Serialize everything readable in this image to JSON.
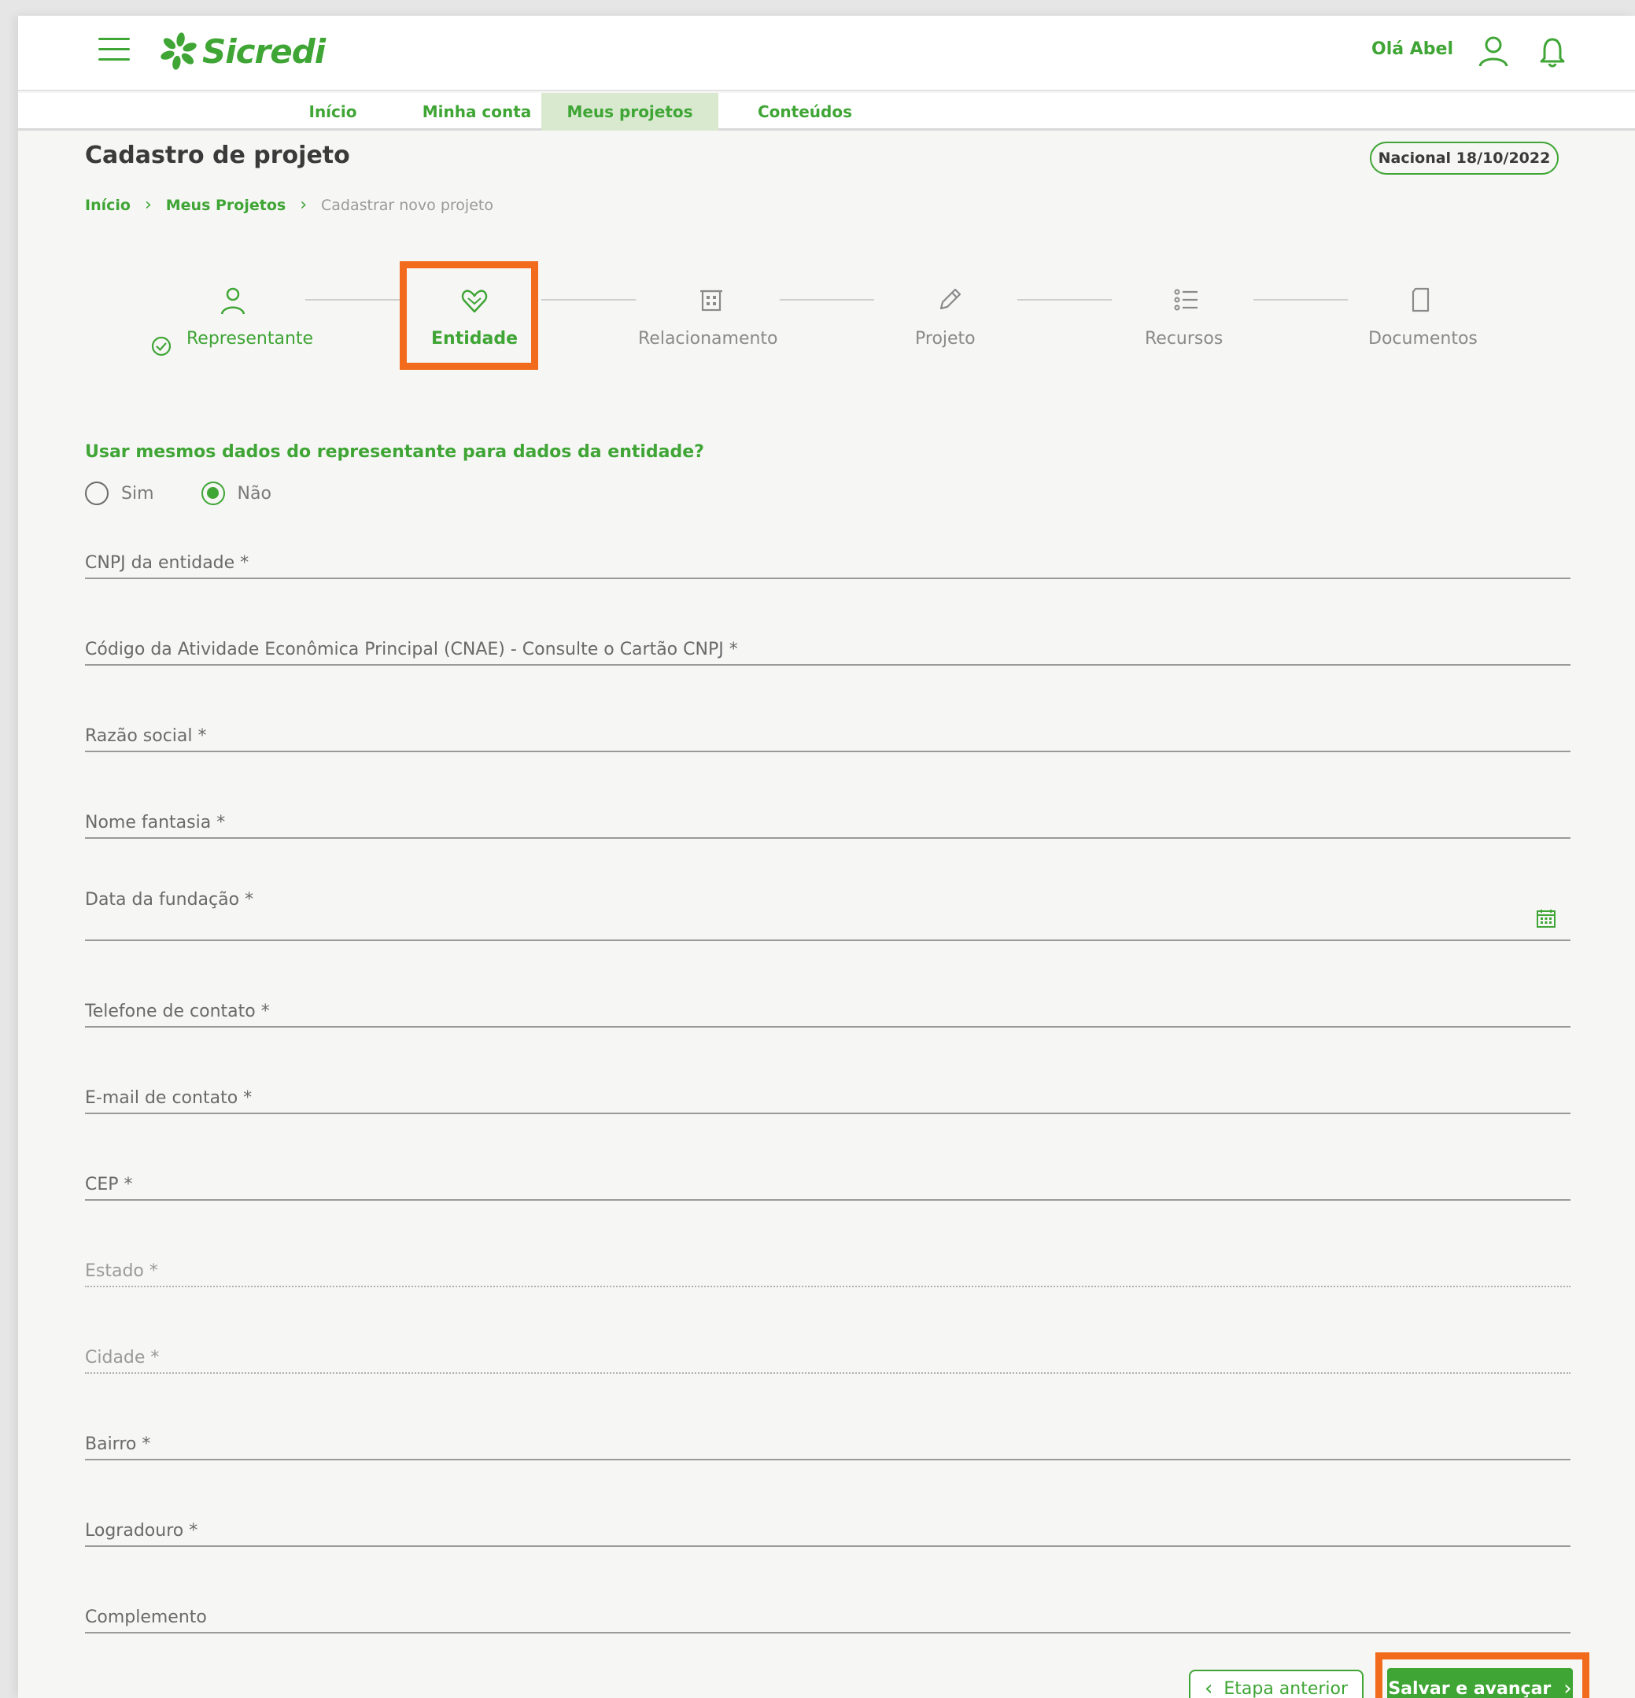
{
  "header": {
    "logo_text": "Sicredi",
    "greeting": "Olá Abel"
  },
  "nav": {
    "tabs": [
      {
        "label": "Início"
      },
      {
        "label": "Minha conta"
      },
      {
        "label": "Meus projetos"
      },
      {
        "label": "Conteúdos"
      }
    ],
    "active_tab": "Meus projetos"
  },
  "page": {
    "title": "Cadastro de projeto",
    "badge": "Nacional 18/10/2022",
    "breadcrumb": [
      "Início",
      "Meus Projetos",
      "Cadastrar novo projeto"
    ]
  },
  "stepper": {
    "steps": [
      {
        "label": "Representante",
        "icon": "user-icon",
        "status": "done"
      },
      {
        "label": "Entidade",
        "icon": "heart-hands-icon",
        "status": "current"
      },
      {
        "label": "Relacionamento",
        "icon": "building-icon",
        "status": "pending"
      },
      {
        "label": "Projeto",
        "icon": "pencil-icon",
        "status": "pending"
      },
      {
        "label": "Recursos",
        "icon": "list-icon",
        "status": "pending"
      },
      {
        "label": "Documentos",
        "icon": "document-icon",
        "status": "pending"
      }
    ]
  },
  "form": {
    "question": "Usar mesmos dados do representante para dados da entidade?",
    "options": [
      "Sim",
      "Não"
    ],
    "selected": "Não",
    "fields": [
      {
        "label": "CNPJ da entidade *"
      },
      {
        "label": "Código da Atividade Econômica Principal (CNAE) - Consulte o Cartão CNPJ *"
      },
      {
        "label": "Razão social *"
      },
      {
        "label": "Nome fantasia *"
      },
      {
        "label": "Data da fundação *"
      },
      {
        "label": "Telefone de contato *"
      },
      {
        "label": "E-mail de contato *"
      },
      {
        "label": "CEP *"
      },
      {
        "label": "Estado *"
      },
      {
        "label": "Cidade *"
      },
      {
        "label": "Bairro *"
      },
      {
        "label": "Logradouro *"
      },
      {
        "label": "Complemento"
      }
    ]
  },
  "actions": {
    "prev": "Etapa anterior",
    "next": "Salvar e avançar"
  },
  "colors": {
    "brand": "#3fa535",
    "highlight": "#f26b1d",
    "active_tab_bg": "#d8e9cf"
  }
}
